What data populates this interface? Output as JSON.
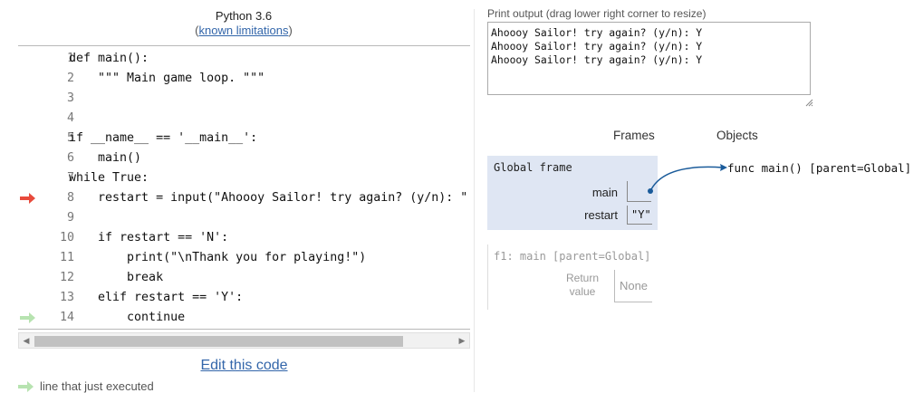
{
  "header": {
    "language": "Python 3.6",
    "limitations_paren_open": "(",
    "limitations_link": "known limitations",
    "limitations_paren_close": ")"
  },
  "code_lines": [
    {
      "num": "1",
      "text": "def main():"
    },
    {
      "num": "2",
      "text": "    \"\"\" Main game loop. \"\"\""
    },
    {
      "num": "3",
      "text": ""
    },
    {
      "num": "4",
      "text": ""
    },
    {
      "num": "5",
      "text": "if __name__ == '__main__':"
    },
    {
      "num": "6",
      "text": "    main()"
    },
    {
      "num": "7",
      "text": "while True:"
    },
    {
      "num": "8",
      "text": "    restart = input(\"Ahoooy Sailor! try again? (y/n): \""
    },
    {
      "num": "9",
      "text": ""
    },
    {
      "num": "10",
      "text": "    if restart == 'N':"
    },
    {
      "num": "11",
      "text": "        print(\"\\nThank you for playing!\")"
    },
    {
      "num": "12",
      "text": "        break"
    },
    {
      "num": "13",
      "text": "    elif restart == 'Y':"
    },
    {
      "num": "14",
      "text": "        continue"
    }
  ],
  "current_line_marker": "8",
  "previous_line_marker": "14",
  "editor": {
    "edit_link": "Edit this code",
    "legend_text": "line that just executed"
  },
  "output": {
    "label": "Print output (drag lower right corner to resize)",
    "text": "Ahoooy Sailor! try again? (y/n): Y\nAhoooy Sailor! try again? (y/n): Y\nAhoooy Sailor! try again? (y/n): Y"
  },
  "viz": {
    "frames_heading": "Frames",
    "objects_heading": "Objects",
    "global_frame": {
      "title": "Global frame",
      "vars": [
        {
          "name": "main",
          "value": ""
        },
        {
          "name": "restart",
          "value": "\"Y\""
        }
      ]
    },
    "stack_frame": {
      "title": "f1: main [parent=Global]",
      "return_label_1": "Return",
      "return_label_2": "value",
      "return_value": "None"
    },
    "function_object": "func main() [parent=Global]"
  },
  "colors": {
    "current_arrow": "#e84a3c",
    "previous_arrow": "#b7e3b0",
    "frame_bg": "#dfe6f3",
    "pointer": "#1a5b9a",
    "link": "#3366aa"
  }
}
